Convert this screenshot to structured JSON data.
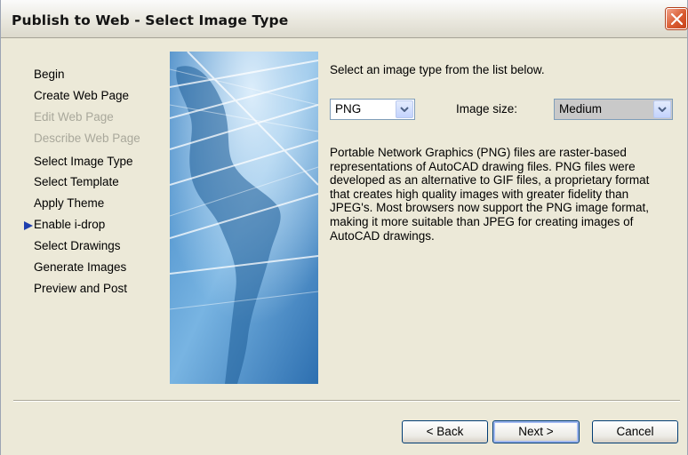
{
  "window": {
    "title": "Publish to Web - Select Image Type"
  },
  "nav": {
    "items": [
      {
        "label": "Begin",
        "state": "enabled"
      },
      {
        "label": "Create Web Page",
        "state": "enabled"
      },
      {
        "label": "Edit Web Page",
        "state": "disabled"
      },
      {
        "label": "Describe Web Page",
        "state": "disabled"
      },
      {
        "label": "Select Image Type",
        "state": "current"
      },
      {
        "label": "Select Template",
        "state": "enabled"
      },
      {
        "label": "Apply Theme",
        "state": "enabled"
      },
      {
        "label": "Enable i-drop",
        "state": "enabled"
      },
      {
        "label": "Select Drawings",
        "state": "enabled"
      },
      {
        "label": "Generate Images",
        "state": "enabled"
      },
      {
        "label": "Preview and Post",
        "state": "enabled"
      }
    ],
    "current_indicator_icon": "arrow-right-icon"
  },
  "main": {
    "prompt": "Select an image type from the list below.",
    "image_type": {
      "selected": "PNG"
    },
    "image_size": {
      "label": "Image size:",
      "selected": "Medium"
    },
    "description": "Portable Network Graphics (PNG) files are raster-based representations of AutoCAD drawing files.  PNG files were developed as an alternative to GIF files, a proprietary format that creates high quality images with greater fidelity than JPEG's.  Most browsers now support the PNG image format, making it more suitable than JPEG for creating images of AutoCAD drawings."
  },
  "buttons": {
    "back": "< Back",
    "next": "Next >",
    "cancel": "Cancel"
  },
  "colors": {
    "disabled_text": "#a9a89b",
    "dialog_face": "#ece9d8",
    "arrow_marker": "#1f3fae"
  }
}
